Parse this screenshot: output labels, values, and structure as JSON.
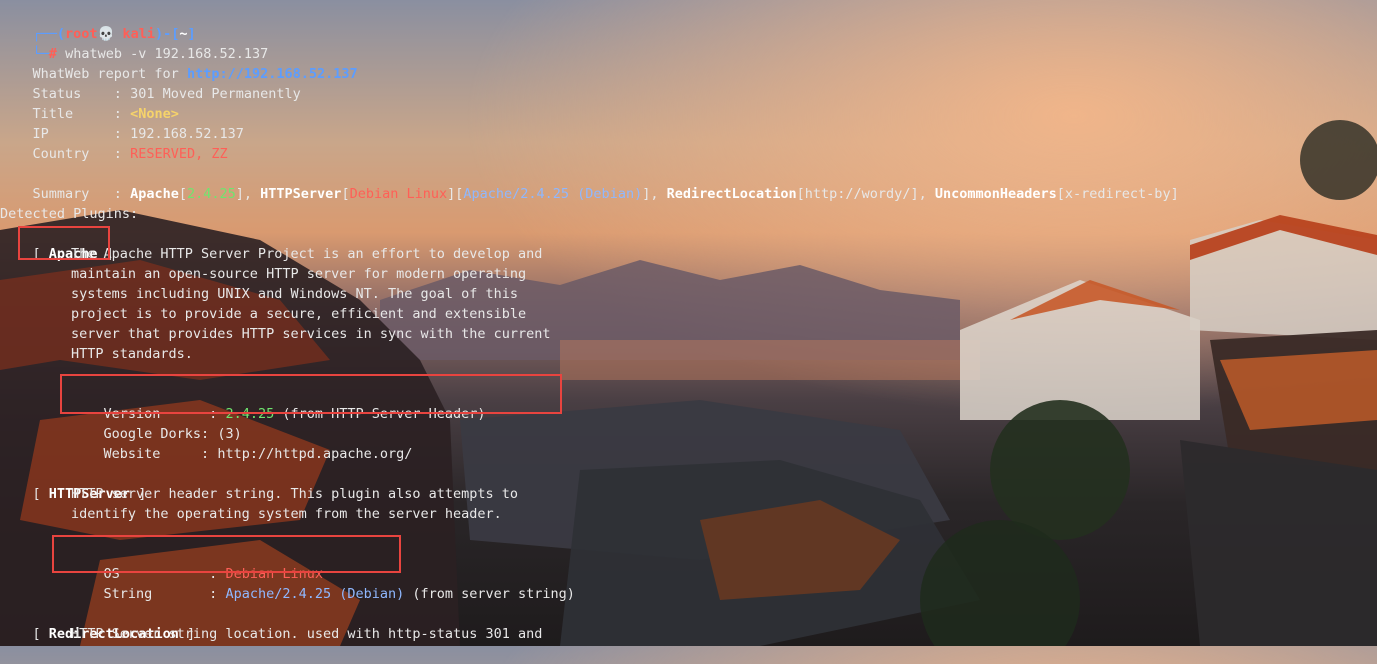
{
  "prompt": {
    "line1_left": "┌──(",
    "user": "root💀 kali",
    "line1_mid": ")-[",
    "dir": "~",
    "line1_right": "]",
    "line2_prefix": "└─",
    "hash": "#",
    "command": "whatweb -v 192.168.52.137"
  },
  "report": {
    "header_label": "WhatWeb report for ",
    "header_url": "http://192.168.52.137",
    "status_label": "Status    : ",
    "status_value": "301 Moved Permanently",
    "title_label": "Title     : ",
    "title_value": "<None>",
    "ip_label": "IP        : ",
    "ip_value": "192.168.52.137",
    "country_label": "Country   : ",
    "country_value": "RESERVED, ZZ"
  },
  "summary": {
    "label": "Summary   : ",
    "apache": "Apache",
    "apache_ver": "2.4.25",
    "sep1": "], ",
    "httpserver": "HTTPServer",
    "os": "Debian Linux",
    "server_str": "Apache/2.4.25 (Debian)",
    "sep2": "], ",
    "redirect": "RedirectLocation",
    "redirect_val": "http://wordy/",
    "sep3": "], ",
    "uncommon": "UncommonHeaders",
    "uncommon_val": "x-redirect-by"
  },
  "plugins": {
    "header": "Detected Plugins:",
    "apache": {
      "name": "Apache",
      "desc": [
        "The Apache HTTP Server Project is an effort to develop and",
        "maintain an open-source HTTP server for modern operating",
        "systems including UNIX and Windows NT. The goal of this",
        "project is to provide a secure, efficient and extensible",
        "server that provides HTTP services in sync with the current",
        "HTTP standards."
      ],
      "version_label": "Version      : ",
      "version_value": "2.4.25",
      "version_note": " (from HTTP Server Header)",
      "dorks_label": "Google Dorks: ",
      "dorks_value": "(3)",
      "website_label": "Website     : ",
      "website_value": "http://httpd.apache.org/"
    },
    "httpserver": {
      "name": "HTTPServer",
      "desc": [
        "HTTP server header string. This plugin also attempts to",
        "identify the operating system from the server header."
      ],
      "os_label": "OS           : ",
      "os_value": "Debian Linux",
      "string_label": "String       : ",
      "string_value": "Apache/2.4.25 (Debian)",
      "string_note": " (from server string)"
    },
    "redirect": {
      "name": "RedirectLocation",
      "desc": [
        "HTTP Server string location. used with http-status 301 and"
      ]
    }
  },
  "colors": {
    "highlight": "#e8443f",
    "prompt_red": "#ff5f57",
    "url_blue": "#5c9dff",
    "version_green": "#6fe56f"
  }
}
